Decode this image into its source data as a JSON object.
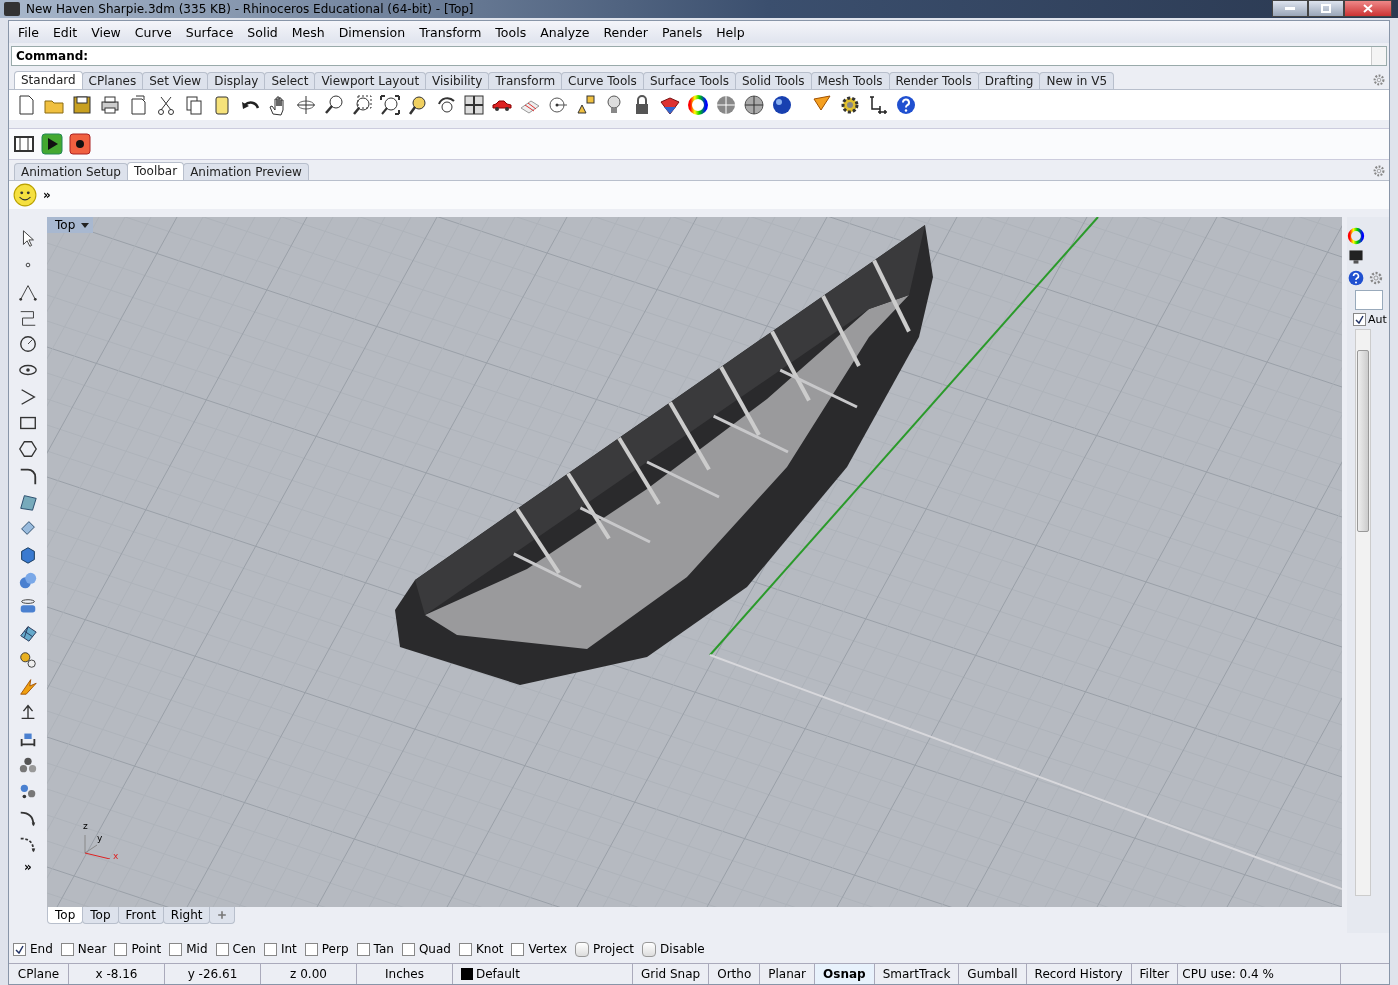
{
  "window": {
    "title": "New Haven Sharpie.3dm (335 KB) - Rhinoceros Educational (64-bit) - [Top]"
  },
  "menu": [
    "File",
    "Edit",
    "View",
    "Curve",
    "Surface",
    "Solid",
    "Mesh",
    "Dimension",
    "Transform",
    "Tools",
    "Analyze",
    "Render",
    "Panels",
    "Help"
  ],
  "command": {
    "label": "Command:"
  },
  "toolbar_tabs": [
    {
      "label": "Standard",
      "selected": true
    },
    {
      "label": "CPlanes",
      "selected": false
    },
    {
      "label": "Set View",
      "selected": false
    },
    {
      "label": "Display",
      "selected": false
    },
    {
      "label": "Select",
      "selected": false
    },
    {
      "label": "Viewport Layout",
      "selected": false
    },
    {
      "label": "Visibility",
      "selected": false
    },
    {
      "label": "Transform",
      "selected": false
    },
    {
      "label": "Curve Tools",
      "selected": false
    },
    {
      "label": "Surface Tools",
      "selected": false
    },
    {
      "label": "Solid Tools",
      "selected": false
    },
    {
      "label": "Mesh Tools",
      "selected": false
    },
    {
      "label": "Render Tools",
      "selected": false
    },
    {
      "label": "Drafting",
      "selected": false
    },
    {
      "label": "New in V5",
      "selected": false
    }
  ],
  "animation_tabs": [
    {
      "label": "Animation Setup",
      "selected": false
    },
    {
      "label": "Toolbar",
      "selected": true
    },
    {
      "label": "Animation Preview",
      "selected": false
    }
  ],
  "toolbar_overflow": "»",
  "left_toolbar_overflow": "»",
  "viewport": {
    "title": "Top",
    "axis_labels": [
      "z",
      "y",
      "x"
    ]
  },
  "viewport_tabs": [
    {
      "label": "Top",
      "selected": true
    },
    {
      "label": "Top",
      "selected": false
    },
    {
      "label": "Front",
      "selected": false
    },
    {
      "label": "Right",
      "selected": false
    }
  ],
  "side_panel": {
    "checkbox": {
      "label": "Aut",
      "checked": true
    }
  },
  "osnaps": [
    {
      "label": "End",
      "checked": true,
      "kind": "checkbox"
    },
    {
      "label": "Near",
      "checked": false,
      "kind": "checkbox"
    },
    {
      "label": "Point",
      "checked": false,
      "kind": "checkbox"
    },
    {
      "label": "Mid",
      "checked": false,
      "kind": "checkbox"
    },
    {
      "label": "Cen",
      "checked": false,
      "kind": "checkbox"
    },
    {
      "label": "Int",
      "checked": false,
      "kind": "checkbox"
    },
    {
      "label": "Perp",
      "checked": false,
      "kind": "checkbox"
    },
    {
      "label": "Tan",
      "checked": false,
      "kind": "checkbox"
    },
    {
      "label": "Quad",
      "checked": false,
      "kind": "checkbox"
    },
    {
      "label": "Knot",
      "checked": false,
      "kind": "checkbox"
    },
    {
      "label": "Vertex",
      "checked": false,
      "kind": "checkbox"
    },
    {
      "label": "Project",
      "checked": false,
      "kind": "toggle"
    },
    {
      "label": "Disable",
      "checked": false,
      "kind": "toggle"
    }
  ],
  "status_bar": [
    {
      "text": "CPlane",
      "kind": "label"
    },
    {
      "text": "x -8.16",
      "kind": "coord"
    },
    {
      "text": "y -26.61",
      "kind": "coord"
    },
    {
      "text": "z 0.00",
      "kind": "coord"
    },
    {
      "text": "Inches",
      "kind": "coord"
    },
    {
      "text": "Default",
      "kind": "layer",
      "color": "#000000"
    },
    {
      "text": "Grid Snap",
      "kind": "toggle",
      "on": false
    },
    {
      "text": "Ortho",
      "kind": "toggle",
      "on": false
    },
    {
      "text": "Planar",
      "kind": "toggle",
      "on": false
    },
    {
      "text": "Osnap",
      "kind": "toggle",
      "on": true
    },
    {
      "text": "SmartTrack",
      "kind": "toggle",
      "on": false
    },
    {
      "text": "Gumball",
      "kind": "toggle",
      "on": false
    },
    {
      "text": "Record History",
      "kind": "toggle",
      "on": false
    },
    {
      "text": "Filter",
      "kind": "toggle",
      "on": false
    },
    {
      "text": "CPU use: 0.4 %",
      "kind": "info"
    }
  ]
}
